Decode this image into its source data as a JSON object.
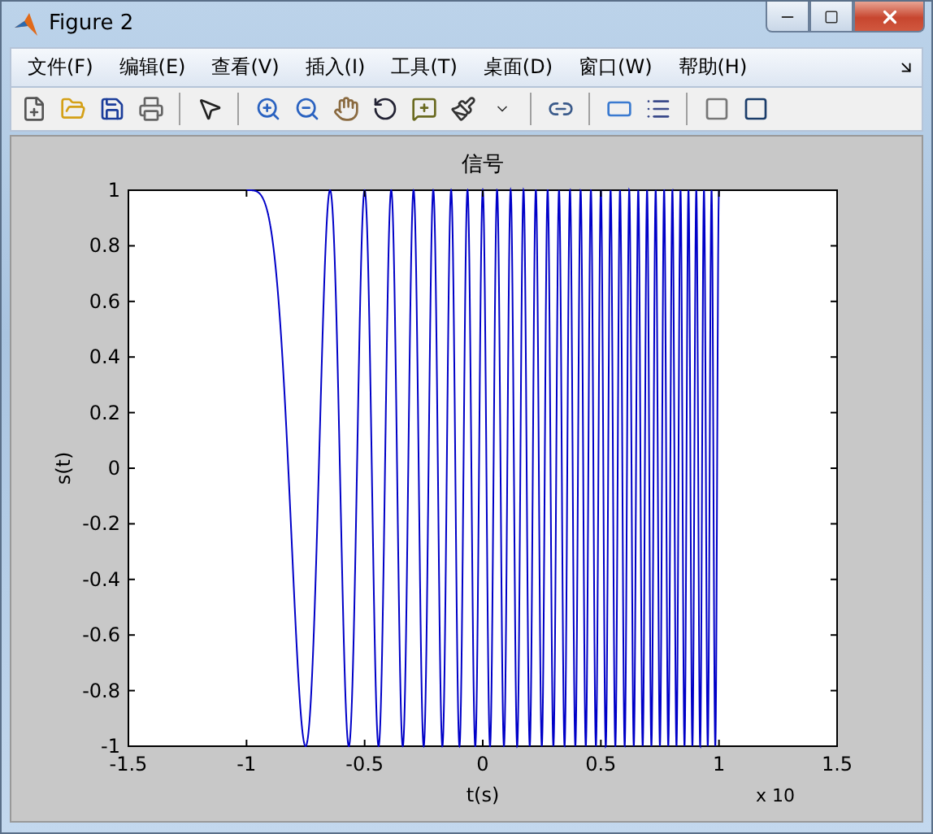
{
  "window": {
    "title": "Figure 2"
  },
  "menu": [
    {
      "label": "文件(F)"
    },
    {
      "label": "编辑(E)"
    },
    {
      "label": "查看(V)"
    },
    {
      "label": "插入(I)"
    },
    {
      "label": "工具(T)"
    },
    {
      "label": "桌面(D)"
    },
    {
      "label": "窗口(W)"
    },
    {
      "label": "帮助(H)"
    }
  ],
  "plot": {
    "title": "信号",
    "xlabel": "t(s)",
    "ylabel": "s(t)",
    "x_exponent": "x 10",
    "xticks": [
      "-1.5",
      "-1",
      "-0.5",
      "0",
      "0.5",
      "1",
      "1.5"
    ],
    "yticks": [
      "1",
      "0.8",
      "0.6",
      "0.4",
      "0.2",
      "0",
      "-0.2",
      "-0.4",
      "-0.6",
      "-0.8",
      "-1"
    ]
  }
}
